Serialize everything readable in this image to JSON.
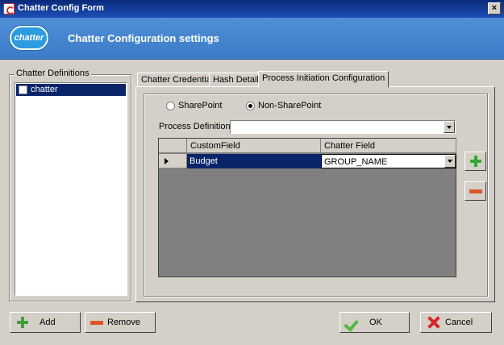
{
  "window": {
    "title": "Chatter Config Form",
    "close_glyph": "×"
  },
  "header": {
    "logo_text": "chatter",
    "title": "Chatter Configuration settings"
  },
  "definitions": {
    "legend": "Chatter Definitions",
    "items": [
      {
        "label": "chatter",
        "checked": false,
        "selected": true
      }
    ]
  },
  "tabs": [
    {
      "label": "Chatter Credentials",
      "active": false
    },
    {
      "label": "Hash Details",
      "active": false
    },
    {
      "label": "Process Initiation Configuration",
      "active": true
    }
  ],
  "process_config": {
    "radio_sharepoint": "SharePoint",
    "radio_nonsharepoint": "Non-SharePoint",
    "selected_radio": "Non-SharePoint",
    "process_definition_label": "Process Definition :",
    "process_definition_value": "",
    "grid": {
      "headers": [
        "CustomField",
        "Chatter Field"
      ],
      "rows": [
        {
          "custom_field": "Budget",
          "chatter_field": "GROUP_NAME"
        }
      ]
    }
  },
  "buttons": {
    "add": "Add",
    "remove": "Remove",
    "ok": "OK",
    "cancel": "Cancel"
  },
  "colors": {
    "title_bar": "#0a2a78",
    "header": "#4a8ad2",
    "selection": "#0a246a",
    "grid_bg": "#808080"
  }
}
